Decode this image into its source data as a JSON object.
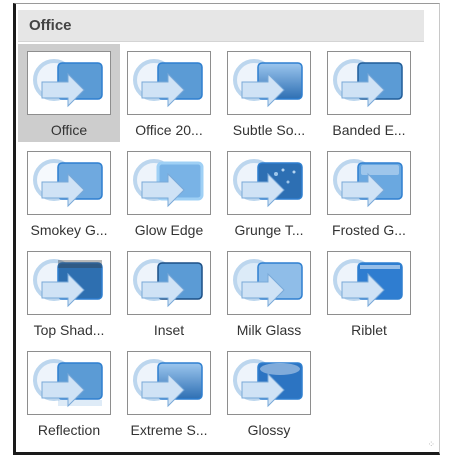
{
  "panel": {
    "header": "Office",
    "items": [
      {
        "label": "Office",
        "style": "plain",
        "selected": true
      },
      {
        "label": "Office 20...",
        "style": "plain"
      },
      {
        "label": "Subtle So...",
        "style": "subtle"
      },
      {
        "label": "Banded E...",
        "style": "banded"
      },
      {
        "label": "Smokey G...",
        "style": "smokey"
      },
      {
        "label": "Glow Edge",
        "style": "glow"
      },
      {
        "label": "Grunge T...",
        "style": "grunge"
      },
      {
        "label": "Frosted G...",
        "style": "frosted"
      },
      {
        "label": "Top Shad...",
        "style": "topshadow"
      },
      {
        "label": "Inset",
        "style": "inset"
      },
      {
        "label": "Milk Glass",
        "style": "milk"
      },
      {
        "label": "Riblet",
        "style": "riblet"
      },
      {
        "label": "Reflection",
        "style": "reflection"
      },
      {
        "label": "Extreme S...",
        "style": "extreme"
      },
      {
        "label": "Glossy",
        "style": "glossy"
      }
    ]
  },
  "colors": {
    "accent_blue": "#2e7fd0",
    "light_blue": "#bcd6ee",
    "mid_blue": "#5b9bd5",
    "selection_gray": "#cdcdcd"
  }
}
